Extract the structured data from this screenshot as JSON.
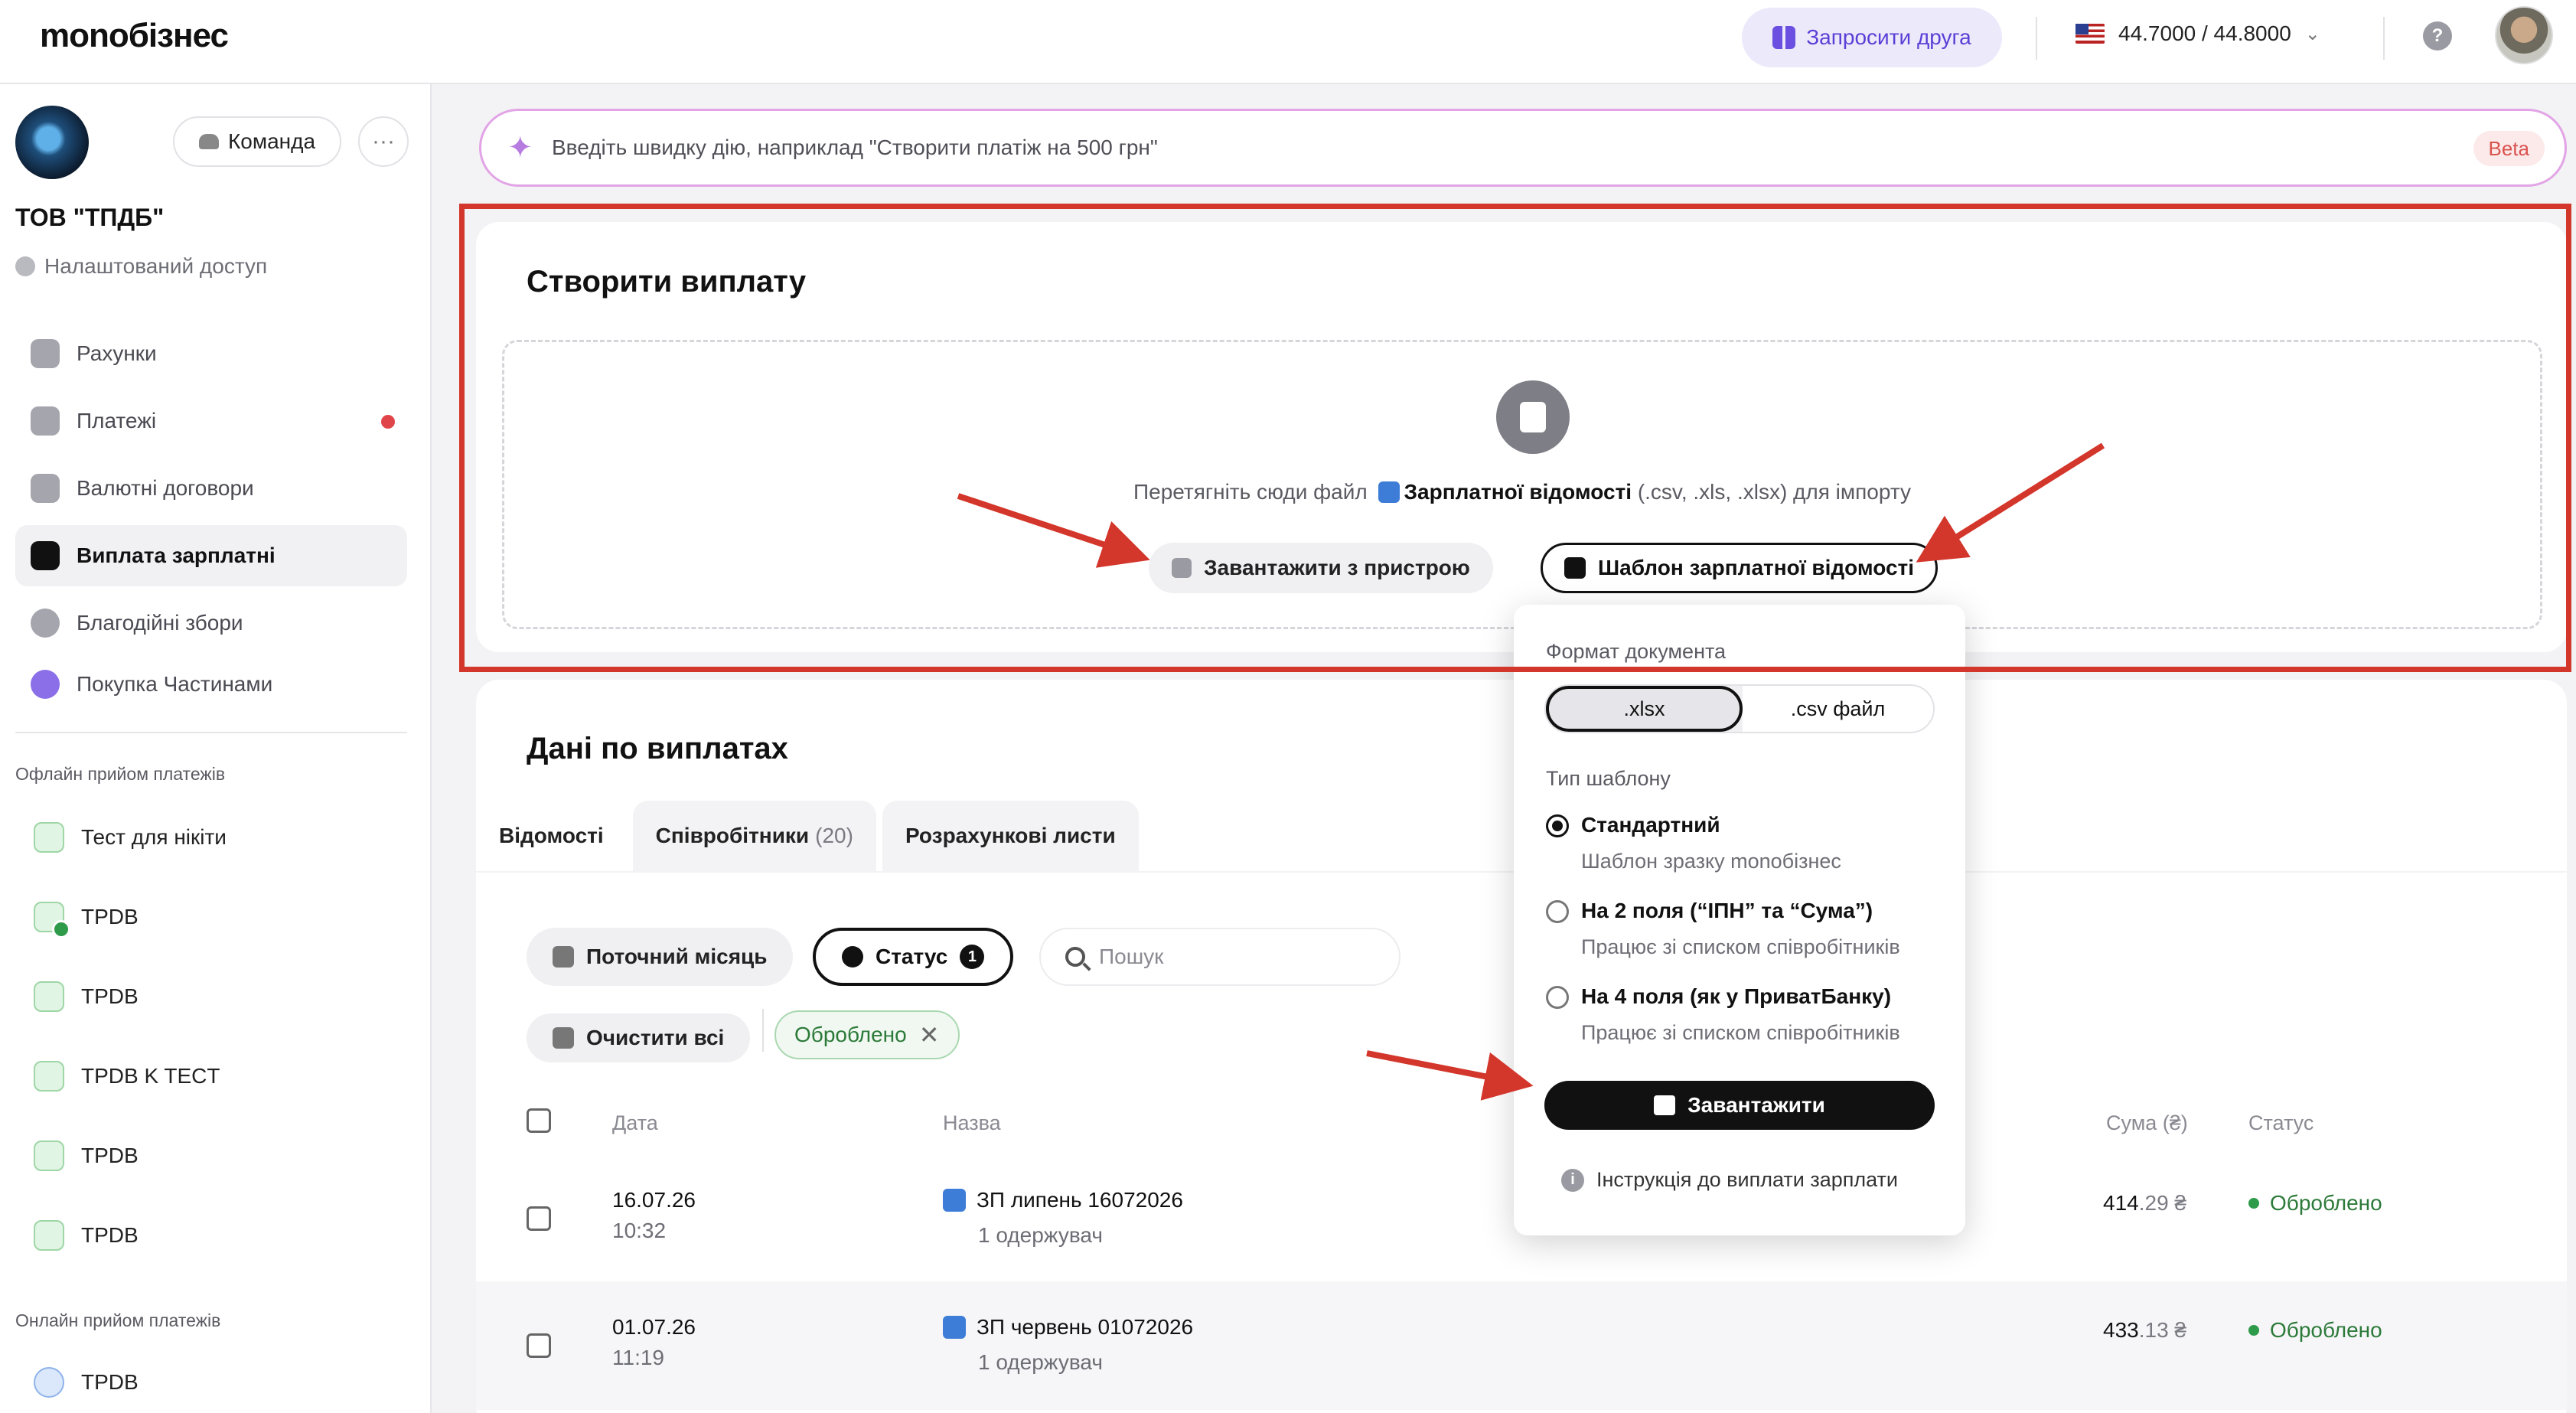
{
  "app": {
    "logo": "monoбізнес"
  },
  "topbar": {
    "invite_label": "Запросити друга",
    "rate": "44.7000 / 44.8000",
    "help": "?"
  },
  "sidebar": {
    "team_label": "Команда",
    "more_label": "···",
    "org_name": "ТОВ \"ТПДБ\"",
    "access": "Налаштований доступ",
    "nav": [
      {
        "label": "Рахунки"
      },
      {
        "label": "Платежі"
      },
      {
        "label": "Валютні договори"
      },
      {
        "label": "Виплата зарплатні"
      },
      {
        "label": "Благодійні збори"
      },
      {
        "label": "Покупка Частинами"
      }
    ],
    "offline_section": "Офлайн прийом платежів",
    "offline_items": [
      {
        "label": "Тест для нікіти"
      },
      {
        "label": "TPDB"
      },
      {
        "label": "TPDB"
      },
      {
        "label": "TPDB K TECT"
      },
      {
        "label": "TPDB"
      },
      {
        "label": "TPDB"
      }
    ],
    "online_section": "Онлайн прийом платежів",
    "online_items": [
      {
        "label": "TPDB"
      }
    ]
  },
  "quick_action": {
    "placeholder": "Введіть швидку дію, наприклад \"Створити платіж на 500 грн\"",
    "badge": "Beta"
  },
  "create_payout": {
    "title": "Створити виплату",
    "drop_prefix": "Перетягніть сюди файл",
    "drop_doc": "Зарплатної відомості",
    "drop_suffix": "(.csv, .xls, .xlsx) для імпорту",
    "upload_button": "Завантажити з пристрою",
    "template_button": "Шаблон зарплатної відомості"
  },
  "payments": {
    "title": "Дані по виплатах",
    "tabs": [
      {
        "label": "Відомості",
        "count": ""
      },
      {
        "label": "Співробітники",
        "count": "(20)"
      },
      {
        "label": "Розрахункові листи",
        "count": ""
      }
    ],
    "filter_month": "Поточний місяць",
    "filter_status": "Статус",
    "filter_status_count": "1",
    "search_placeholder": "Пошук",
    "clear_all": "Очистити всі",
    "active_filter": "Оброблено",
    "columns": {
      "date": "Дата",
      "name": "Назва",
      "amount": "Сума (₴)",
      "status": "Статус"
    },
    "rows": [
      {
        "date": "16.07.26",
        "time": "10:32",
        "name": "ЗП липень 16072026",
        "recipients": "1 одержувач",
        "amount_int": "414",
        "amount_dec": ".29 ₴",
        "status": "Оброблено"
      },
      {
        "date": "01.07.26",
        "time": "11:19",
        "name": "ЗП червень 01072026",
        "recipients": "1 одержувач",
        "amount_int": "433",
        "amount_dec": ".13 ₴",
        "status": "Оброблено"
      }
    ]
  },
  "template_popover": {
    "format_label": "Формат документа",
    "format_options": [
      ".xlsx",
      ".csv файл"
    ],
    "type_label": "Тип шаблону",
    "options": [
      {
        "title": "Стандартний",
        "subtitle": "Шаблон зразку monoбізнес"
      },
      {
        "title": "На 2 поля (“ІПН” та “Сума”)",
        "subtitle": "Працює зі списком співробітників"
      },
      {
        "title": "На 4 поля (як у ПриватБанку)",
        "subtitle": "Працює зі списком співробітників"
      }
    ],
    "download_button": "Завантажити",
    "instruction_link": "Інструкція до виплати зарплати"
  },
  "annotation_color": "#d3362b"
}
